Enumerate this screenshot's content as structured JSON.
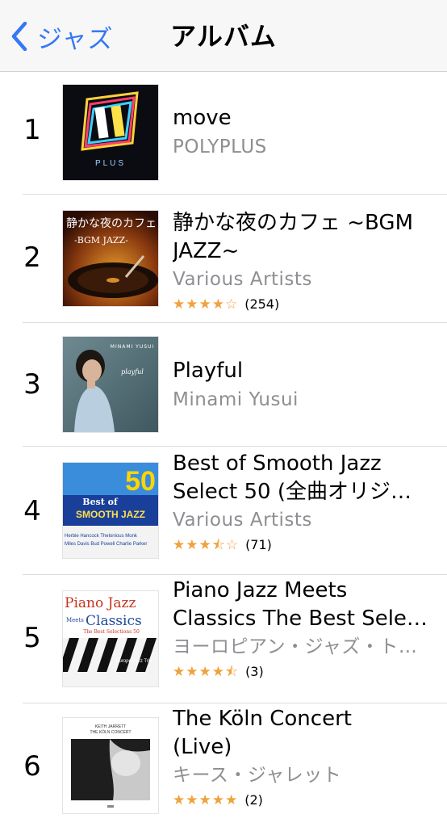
{
  "nav": {
    "back_label": "ジャズ",
    "title": "アルバム"
  },
  "albums": [
    {
      "rank": "1",
      "title_lines": [
        "move"
      ],
      "artist": "POLYPLUS",
      "stars": "",
      "count": "",
      "art_icon": "polyplus-cover"
    },
    {
      "rank": "2",
      "title_lines": [
        "静かな夜のカフェ ~BGM",
        "JAZZ~"
      ],
      "artist": "Various Artists",
      "stars": "★★★★☆",
      "count": "(254)",
      "art_icon": "turntable-cover",
      "art_text": {
        "line1": "静かな夜のカフェ",
        "line2": "-BGM JAZZ-"
      }
    },
    {
      "rank": "3",
      "title_lines": [
        "Playful"
      ],
      "artist": "Minami Yusui",
      "stars": "",
      "count": "",
      "art_icon": "portrait-cover",
      "art_text": {
        "line1": "MINAMI YUSUI",
        "line2": "playful"
      }
    },
    {
      "rank": "4",
      "title_lines": [
        "Best of Smooth Jazz",
        "Select 50 (全曲オリジ…"
      ],
      "artist": "Various Artists",
      "stars": "★★★⯪☆",
      "count": "(71)",
      "art_icon": "smooth-jazz-cover",
      "art_text": {
        "line1": "50",
        "line2": "Best of",
        "line3": "SMOOTH JAZZ",
        "line4": "Herbie Hancock  Thelonious Monk",
        "line5": "Miles Davis  Bud Powell  Charlie Parker"
      }
    },
    {
      "rank": "5",
      "title_lines": [
        "Piano Jazz Meets",
        "Classics The Best Sele…"
      ],
      "artist": "ヨーロピアン・ジャズ・ト…",
      "stars": "★★★★⯪",
      "count": "(3)",
      "art_icon": "piano-keys-cover",
      "art_text": {
        "line1": "Piano Jazz",
        "line2": "Meets",
        "line3": "Classics",
        "line4": "The Best Selections 50",
        "line5": "Europe Jazz Trio"
      }
    },
    {
      "rank": "6",
      "title_lines": [
        "The Köln Concert",
        "(Live)"
      ],
      "artist": "キース・ジャレット",
      "stars": "★★★★★",
      "count": "(2)",
      "art_icon": "koln-concert-cover",
      "art_text": {
        "line1": "KEITH JARRETT",
        "line2": "THE KÖLN CONCERT"
      }
    }
  ],
  "colors": {
    "accent": "#3478f6",
    "star": "#f0a23b",
    "secondary_text": "#8e8e93"
  }
}
